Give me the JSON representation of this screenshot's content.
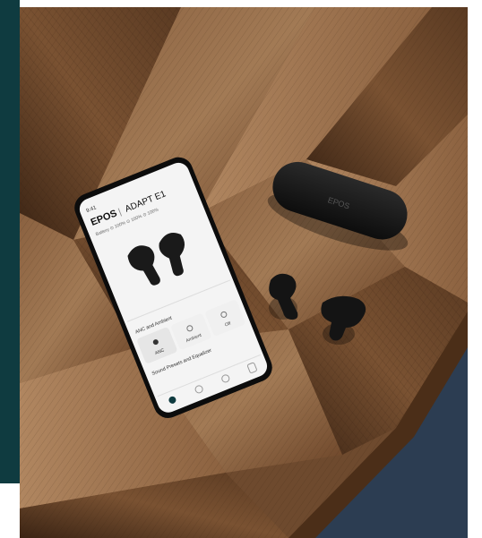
{
  "colors": {
    "teal_panel": "#0f3b40",
    "wood_dark": "#3b2414",
    "wood_mid": "#7a5232",
    "wood_light": "#a27a55",
    "rug": "#2c3d52",
    "device_black": "#151515",
    "phone_screen": "#f4f4f4"
  },
  "phone": {
    "time": "9:41",
    "brand": "EPOS",
    "separator": "|",
    "model": "ADAPT E1",
    "battery": "Battery   ⊙ 100%   ⊙ 100%   ⊙ 100%",
    "anc_section": "ANC and Ambient",
    "mode_anc": "ANC",
    "mode_ambient": "Ambient",
    "mode_off": "Off",
    "eq_section": "Sound Presets and Equalizer"
  },
  "case": {
    "logo": "EPOS"
  },
  "icons": {
    "home": "home-icon",
    "headset": "headset-icon",
    "settings": "settings-icon",
    "mobile": "mobile-icon",
    "anc": "anc-icon",
    "ambient": "ambient-icon",
    "off": "off-icon"
  }
}
